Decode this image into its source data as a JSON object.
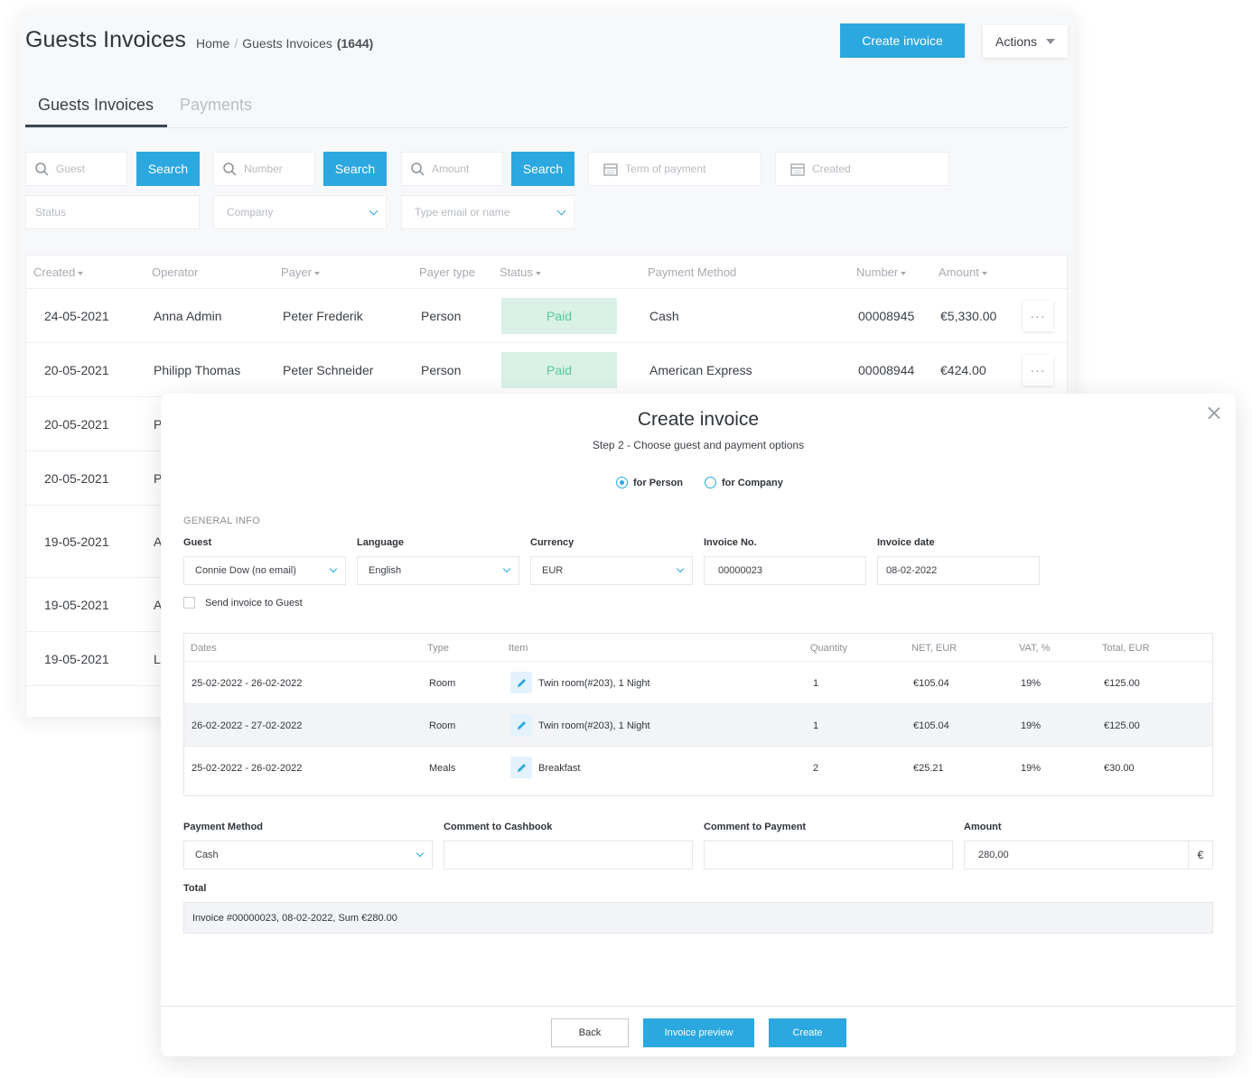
{
  "header": {
    "title": "Guests Invoices",
    "breadcrumb_home": "Home",
    "breadcrumb_sep": "/",
    "breadcrumb_current": "Guests Invoices",
    "breadcrumb_count": "(1644)",
    "create_invoice_label": "Create invoice",
    "actions_label": "Actions"
  },
  "tabs": [
    {
      "label": "Guests Invoices",
      "active": true
    },
    {
      "label": "Payments",
      "active": false
    }
  ],
  "filters": {
    "guest_placeholder": "Guest",
    "number_placeholder": "Number",
    "amount_placeholder": "Amount",
    "search_label": "Search",
    "term_placeholder": "Term of payment",
    "created_placeholder": "Created",
    "status_placeholder": "Status",
    "company_placeholder": "Company",
    "email_placeholder": "Type email or name"
  },
  "invoices_table": {
    "columns": [
      "Created",
      "Operator",
      "Payer",
      "Payer type",
      "Status",
      "Payment Method",
      "Number",
      "Amount"
    ],
    "rows": [
      {
        "created": "24-05-2021",
        "operator": "Anna Admin",
        "payer": "Peter Frederik",
        "payer_type": "Person",
        "status": "Paid",
        "method": "Cash",
        "number": "00008945",
        "amount": "€5,330.00"
      },
      {
        "created": "20-05-2021",
        "operator": "Philipp Thomas",
        "payer": "Peter Schneider",
        "payer_type": "Person",
        "status": "Paid",
        "method": "American Express",
        "number": "00008944",
        "amount": "€424.00"
      },
      {
        "created": "20-05-2021",
        "operator": "P"
      },
      {
        "created": "20-05-2021",
        "operator": "P"
      },
      {
        "created": "19-05-2021",
        "operator": "A"
      },
      {
        "created": "19-05-2021",
        "operator": "A"
      },
      {
        "created": "19-05-2021",
        "operator": "L"
      }
    ],
    "more_label": "···"
  },
  "modal": {
    "title": "Create invoice",
    "subtitle": "Step 2 - Choose guest and payment options",
    "radio_person": "for Person",
    "radio_company": "for Company",
    "section_general": "GENERAL INFO",
    "guest_label": "Guest",
    "guest_value": "Connie Dow (no email)",
    "language_label": "Language",
    "language_value": "English",
    "currency_label": "Currency",
    "currency_value": "EUR",
    "invoice_no_label": "Invoice No.",
    "invoice_no_value": "00000023",
    "invoice_date_label": "Invoice date",
    "invoice_date_value": "08-02-2022",
    "send_invoice_label": "Send invoice to Guest",
    "items_columns": [
      "Dates",
      "Type",
      "Item",
      "Quantity",
      "NET, EUR",
      "VAT, %",
      "Total, EUR"
    ],
    "items": [
      {
        "dates": "25-02-2022 - 26-02-2022",
        "type": "Room",
        "item": "Twin room(#203), 1 Night",
        "qty": "1",
        "net": "€105.04",
        "vat": "19%",
        "total": "€125.00"
      },
      {
        "dates": "26-02-2022 - 27-02-2022",
        "type": "Room",
        "item": "Twin room(#203), 1 Night",
        "qty": "1",
        "net": "€105.04",
        "vat": "19%",
        "total": "€125.00"
      },
      {
        "dates": "25-02-2022 - 26-02-2022",
        "type": "Meals",
        "item": "Breakfast",
        "qty": "2",
        "net": "€25.21",
        "vat": "19%",
        "total": "€30.00"
      }
    ],
    "payment_method_label": "Payment Method",
    "payment_method_value": "Cash",
    "comment_cashbook_label": "Comment to Cashbook",
    "comment_payment_label": "Comment to Payment",
    "amount_label": "Amount",
    "amount_value": "280,00",
    "currency_symbol": "€",
    "total_label": "Total",
    "total_value": "Invoice #00000023, 08-02-2022, Sum €280.00",
    "back_label": "Back",
    "preview_label": "Invoice preview",
    "create_label": "Create"
  },
  "colors": {
    "accent": "#2ba8e0",
    "paid_bg": "#d9f1e7",
    "paid_text": "#5cc79b"
  }
}
